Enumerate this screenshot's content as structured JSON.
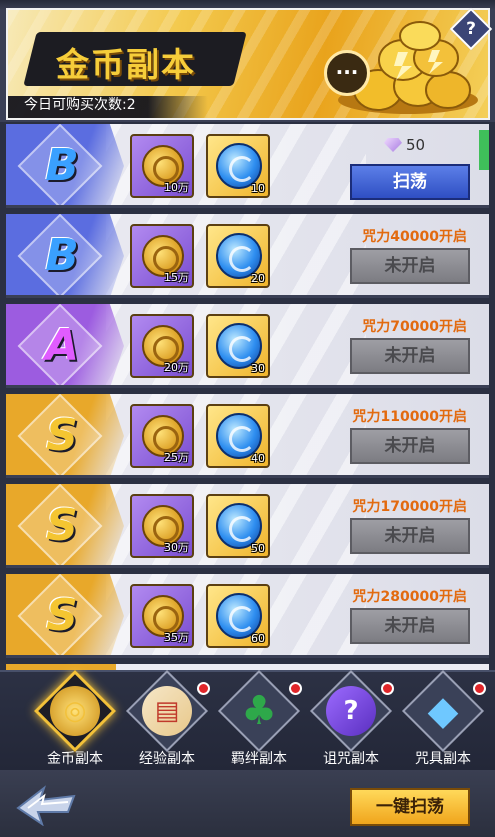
{
  "banner": {
    "title": "金币副本",
    "purchase_text": "今日可购买次数:2",
    "help_glyph": "?"
  },
  "rows": [
    {
      "rank": "B",
      "rank_color": "#3aa0ff",
      "panel_color": "#5b6de0",
      "rewards": [
        {
          "qty": "10万"
        },
        {
          "qty": "10"
        }
      ],
      "cost": "50",
      "button": "扫荡",
      "unlocked": true
    },
    {
      "rank": "B",
      "rank_color": "#3aa0ff",
      "panel_color": "#5b6de0",
      "rewards": [
        {
          "qty": "15万"
        },
        {
          "qty": "20"
        }
      ],
      "requirement": "咒力40000开启",
      "button": "未开启",
      "unlocked": false
    },
    {
      "rank": "A",
      "rank_color": "#e05cff",
      "panel_color": "#9c5ce0",
      "rewards": [
        {
          "qty": "20万"
        },
        {
          "qty": "30"
        }
      ],
      "requirement": "咒力70000开启",
      "button": "未开启",
      "unlocked": false
    },
    {
      "rank": "S",
      "rank_color": "#f4c531",
      "panel_color": "#e8a82a",
      "rewards": [
        {
          "qty": "25万"
        },
        {
          "qty": "40"
        }
      ],
      "requirement": "咒力110000开启",
      "button": "未开启",
      "unlocked": false
    },
    {
      "rank": "S",
      "rank_color": "#f4c531",
      "panel_color": "#e8a82a",
      "rewards": [
        {
          "qty": "30万"
        },
        {
          "qty": "50"
        }
      ],
      "requirement": "咒力170000开启",
      "button": "未开启",
      "unlocked": false
    },
    {
      "rank": "S",
      "rank_color": "#f4c531",
      "panel_color": "#e8a82a",
      "rewards": [
        {
          "qty": "35万"
        },
        {
          "qty": "60"
        }
      ],
      "requirement": "咒力280000开启",
      "button": "未开启",
      "unlocked": false
    }
  ],
  "tabs": [
    {
      "label": "金币副本",
      "icon": "coin-icon",
      "active": true,
      "dot": false
    },
    {
      "label": "经验副本",
      "icon": "book-icon",
      "active": false,
      "dot": true
    },
    {
      "label": "羁绊副本",
      "icon": "clover-icon",
      "active": false,
      "dot": true
    },
    {
      "label": "诅咒副本",
      "icon": "question-card-icon",
      "active": false,
      "dot": true
    },
    {
      "label": "咒具副本",
      "icon": "crystal-icon",
      "active": false,
      "dot": true
    }
  ],
  "bottom": {
    "one_key_label": "一键扫荡"
  }
}
